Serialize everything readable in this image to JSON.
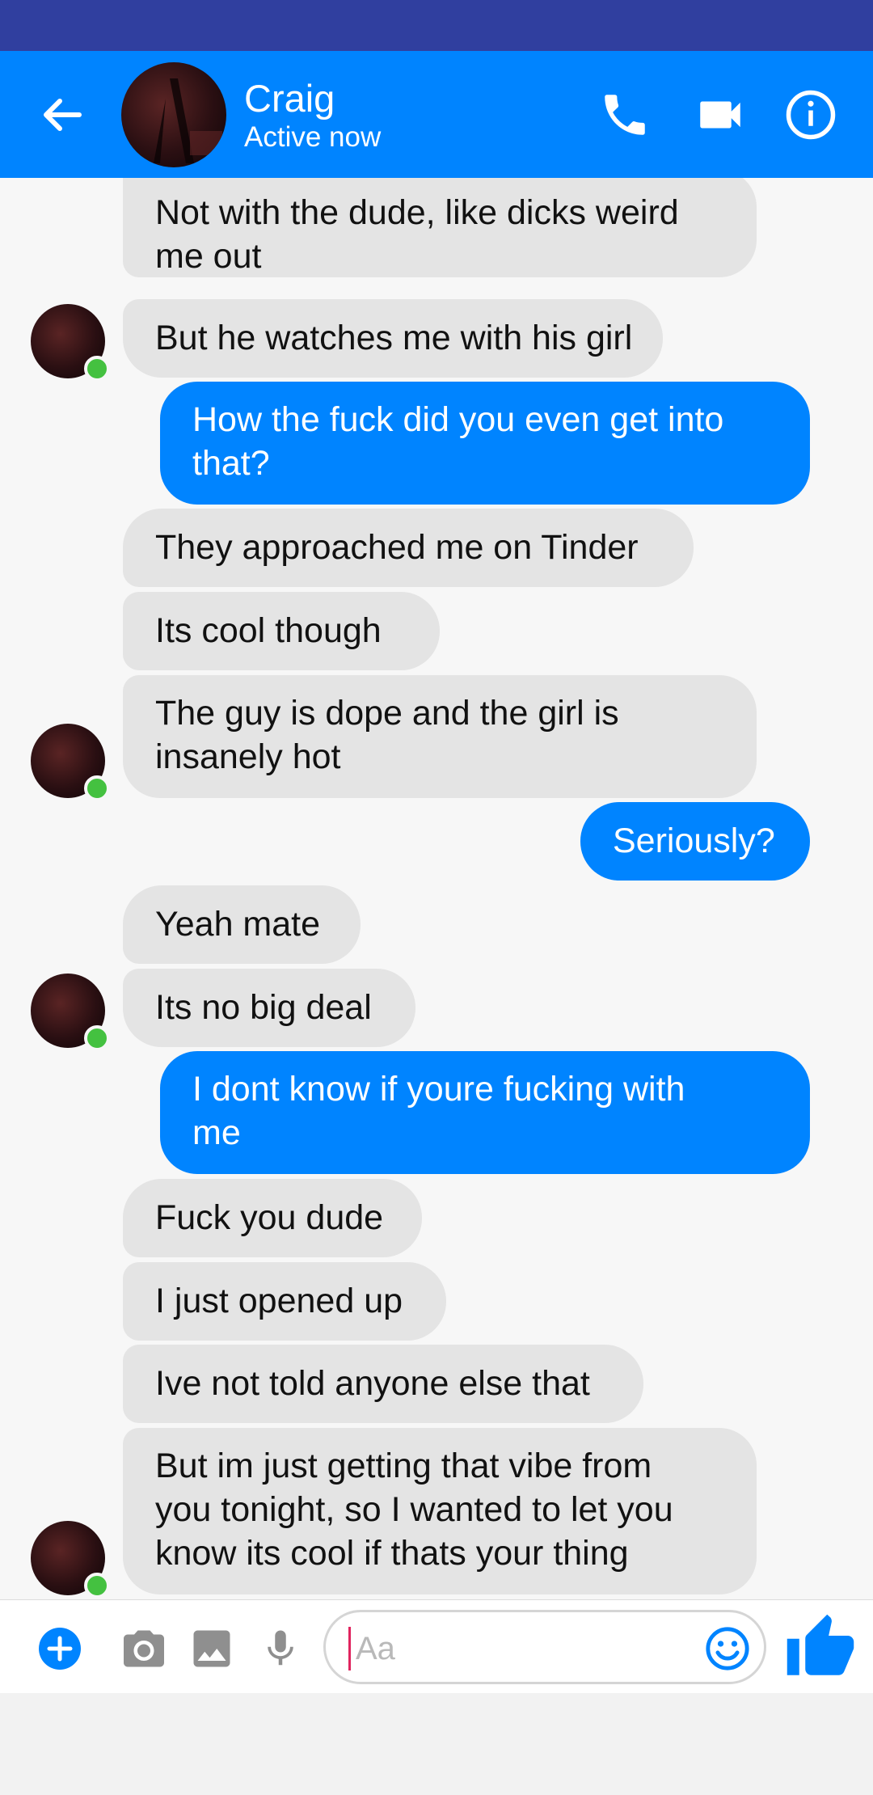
{
  "header": {
    "contact_name": "Craig",
    "contact_status": "Active now"
  },
  "messages": [
    {
      "from": "contact",
      "text_lines": [
        "Not with the dude, like dicks weird",
        "me out"
      ]
    },
    {
      "from": "contact",
      "text_lines": [
        "But he watches me with his girl"
      ]
    },
    {
      "from": "me",
      "text_lines": [
        "How the fuck did you even get into",
        "that?"
      ]
    },
    {
      "from": "contact",
      "text_lines": [
        "They approached me on Tinder"
      ]
    },
    {
      "from": "contact",
      "text_lines": [
        "Its cool though"
      ]
    },
    {
      "from": "contact",
      "text_lines": [
        "The guy is dope and the girl is",
        "insanely hot"
      ]
    },
    {
      "from": "me",
      "text_lines": [
        "Seriously?"
      ]
    },
    {
      "from": "contact",
      "text_lines": [
        "Yeah mate"
      ]
    },
    {
      "from": "contact",
      "text_lines": [
        "Its no big deal"
      ]
    },
    {
      "from": "me",
      "text_lines": [
        "I dont know if youre fucking with",
        "me"
      ]
    },
    {
      "from": "contact",
      "text_lines": [
        "Fuck you dude"
      ]
    },
    {
      "from": "contact",
      "text_lines": [
        "I just opened up"
      ]
    },
    {
      "from": "contact",
      "text_lines": [
        "Ive not told anyone else that"
      ]
    },
    {
      "from": "contact",
      "text_lines": [
        "But im just getting that vibe from",
        "you tonight, so I wanted to let you",
        "know its cool if thats your thing"
      ]
    }
  ],
  "composer": {
    "placeholder": "Aa"
  },
  "colors": {
    "status_bar": "#303f9f",
    "accent": "#0084ff",
    "incoming_bubble": "#e4e4e4",
    "online_dot": "#44c140"
  },
  "icons": {
    "back": "arrow-left-icon",
    "call": "phone-icon",
    "video": "video-camera-icon",
    "info": "info-icon",
    "add": "plus-circle-icon",
    "camera": "camera-icon",
    "gallery": "image-icon",
    "mic": "microphone-icon",
    "emoji": "smiley-icon",
    "like": "thumbs-up-icon"
  }
}
